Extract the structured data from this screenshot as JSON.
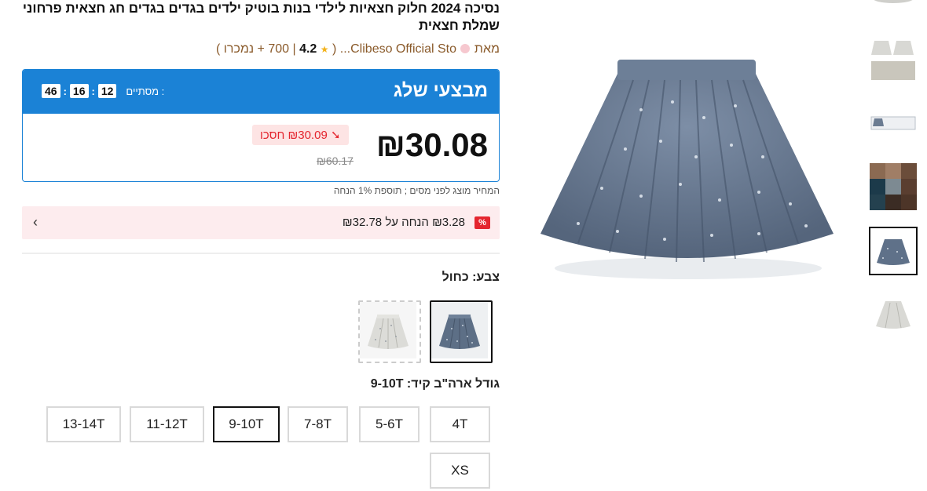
{
  "product": {
    "title": "נסיכה 2024 חלוק חצאיות לילדי בנות בוטיק ילדים בגדים בגדים חג חצאית פרחוני שמלת חצאית",
    "by_label": "מאת",
    "store_name": "Clibeso Official Sto...",
    "open_paren": "(",
    "review_count": "700",
    "separator": "|",
    "rating": "4.2",
    "sold_label": "+ נמכרו",
    "close_paren": ")"
  },
  "deal": {
    "title": "מבצעי שלג",
    "ends_label": "מסתיים :",
    "hours": "12",
    "minutes": "16",
    "seconds": "46",
    "price": "₪30.08",
    "save_badge": "➘ ₪30.09 חסכו",
    "original_price": "₪60.17"
  },
  "tax_note": "המחיר מוצג לפני מסים ; תוספת 1% הנחה",
  "coupon": {
    "icon_text": "%",
    "text": "₪3.28 הנחה על ₪32.78"
  },
  "color": {
    "label": "צבע: כחול",
    "options": [
      "כחול",
      "לבן"
    ]
  },
  "size": {
    "label": "גודל ארה\"ב קיד: 9-10T",
    "options": [
      "4T",
      "5-6T",
      "7-8T",
      "9-10T",
      "11-12T",
      "13-14T",
      "XS"
    ],
    "selected": "9-10T"
  },
  "colors": {
    "deal_blue": "#1b82d6",
    "accent_red": "#e4262f",
    "coupon_bg": "#fdecee"
  },
  "icons": {
    "coupon_chevron": "chevron-left-icon",
    "rating_star": "star-icon"
  }
}
